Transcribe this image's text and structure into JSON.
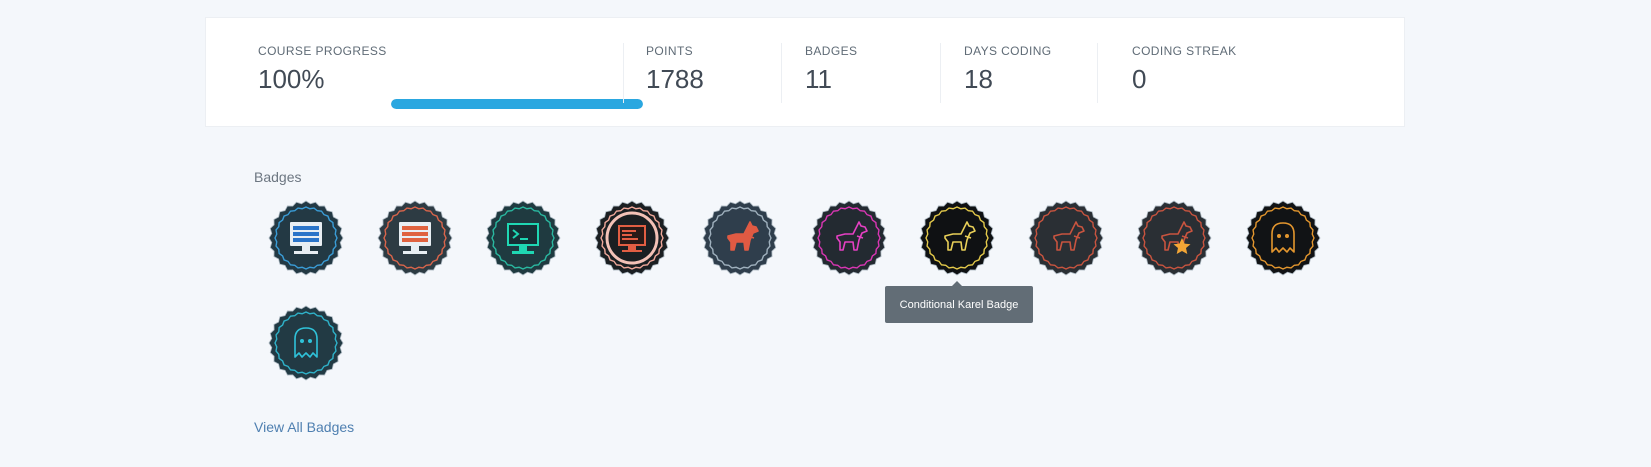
{
  "stats": {
    "course_progress": {
      "label": "COURSE PROGRESS",
      "value": "100%",
      "fraction": 1.0,
      "color": "#2aa7e0"
    },
    "points": {
      "label": "POINTS",
      "value": "1788"
    },
    "badges": {
      "label": "BADGES",
      "value": "11"
    },
    "days_coding": {
      "label": "DAYS CODING",
      "value": "18"
    },
    "coding_streak": {
      "label": "CODING STREAK",
      "value": "0"
    }
  },
  "badges_section": {
    "title": "Badges",
    "tooltip": "Conditional Karel Badge",
    "view_all": "View All Badges",
    "items": [
      {
        "icon": "computer-blue-screen-icon",
        "ring": "#3a9cd6",
        "fill": "#233944",
        "accent": "#2a74c9"
      },
      {
        "icon": "computer-orange-screen-icon",
        "ring": "#d9654b",
        "fill": "#2d3b43",
        "accent": "#e0623f"
      },
      {
        "icon": "terminal-icon",
        "ring": "#2ab8a0",
        "fill": "#1f3a40",
        "accent": "#1fd7b3"
      },
      {
        "icon": "code-monitor-icon",
        "ring": "#f0a89a",
        "fill": "#1b1f22",
        "accent": "#e25e43"
      },
      {
        "icon": "karel-dog-icon",
        "ring": "#9fb0bd",
        "fill": "#2f3e4c",
        "accent": "#e05a43"
      },
      {
        "icon": "karel-dog-icon",
        "ring": "#d936b3",
        "fill": "#232a31",
        "accent": "#e540c3"
      },
      {
        "icon": "karel-dog-icon",
        "ring": "#e3c94a",
        "fill": "#0f1113",
        "accent": "#e8cf58"
      },
      {
        "icon": "karel-dog-icon",
        "ring": "#c8543f",
        "fill": "#2a2f34",
        "accent": "#c8543f"
      },
      {
        "icon": "karel-dog-star-icon",
        "ring": "#c8543f",
        "fill": "#2a2f34",
        "accent": "#f3a636"
      },
      {
        "icon": "ghost-icon",
        "ring": "#e3962e",
        "fill": "#111315",
        "accent": "#e3962e"
      },
      {
        "icon": "ghost-icon",
        "ring": "#2fb2c9",
        "fill": "#223a44",
        "accent": "#2fc2d9"
      }
    ]
  }
}
